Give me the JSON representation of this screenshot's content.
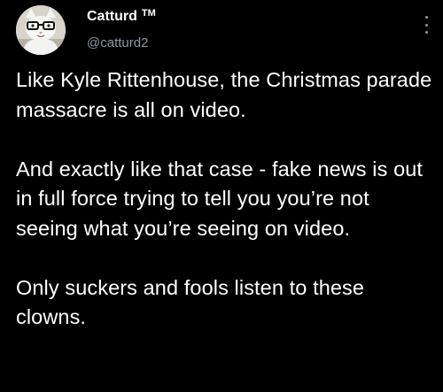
{
  "author": {
    "display_name": "Catturd",
    "badge": "TM",
    "handle": "@catturd2",
    "avatar_icon": "cat-with-glasses-avatar-icon"
  },
  "menu": {
    "icon": "more-vertical-icon"
  },
  "tweet": {
    "paragraphs": [
      "Like Kyle Rittenhouse, the Christmas parade massacre is all on video.",
      "And exactly like that case - fake news is out in full force trying to tell you you’re not seeing what you’re seeing on video.",
      "Only suckers and fools listen to these clowns."
    ]
  },
  "colors": {
    "background": "#000000",
    "text": "#ffffff",
    "secondary_text": "#8b98a5"
  }
}
